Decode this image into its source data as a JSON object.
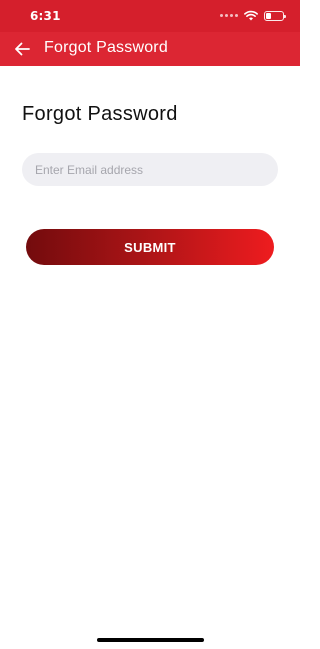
{
  "status_bar": {
    "time": "6:31",
    "battery_level": 0.3
  },
  "app_bar": {
    "back_icon": "arrow-left-icon",
    "title": "Forgot Password"
  },
  "main": {
    "heading": "Forgot Password",
    "email_input": {
      "value": "",
      "placeholder": "Enter Email address"
    },
    "submit_label": "SUBMIT"
  },
  "colors": {
    "status_bar": "#d51f2c",
    "app_bar": "#dc2633",
    "input_background": "#efeff3",
    "button_gradient_start": "#730b0d",
    "button_gradient_end": "#ee1c1f"
  }
}
